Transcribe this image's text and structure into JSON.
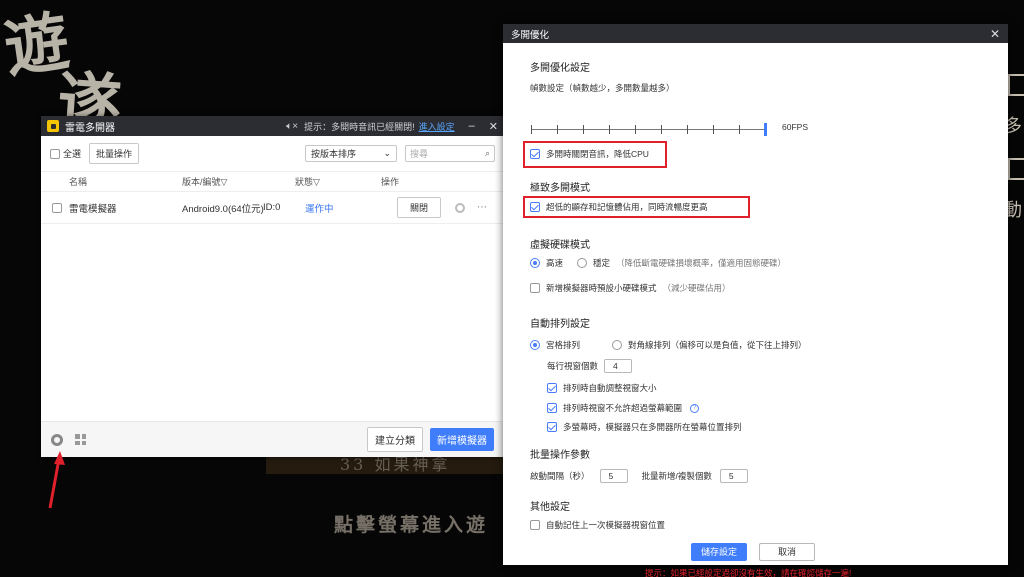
{
  "background": {
    "glyph_a": "遊",
    "glyph_b": "遂",
    "caption_line": "33 如果神拿",
    "caption_sub": "點擊螢幕進入遊",
    "right_glyph_1": "多",
    "right_glyph_2": "動"
  },
  "manager": {
    "title": "雷電多開器",
    "tip": "提示：多開時音訊已經關閉!",
    "tip_link": "進入設定",
    "minimize": "–",
    "close": "✕",
    "select_all": "全選",
    "batch_label": "批量操作",
    "sort_label": "按版本排序",
    "search_placeholder": "搜尋",
    "columns": {
      "name": "名稱",
      "version": "版本/編號",
      "status": "狀態",
      "action": "操作"
    },
    "row": {
      "name": "雷電模擬器",
      "version": "Android9.0(64位元)",
      "id": "ID:0",
      "status": "運作中",
      "action": "關閉",
      "more": "⋯"
    },
    "create_group": "建立分類",
    "new_emulator": "新增模擬器"
  },
  "dialog": {
    "title": "多開優化",
    "close": "✕",
    "section1": {
      "heading": "多開優化設定",
      "fps_label": "幀數設定（幀數越少，多開數量越多）",
      "fps_value_label": "60FPS",
      "fps_level": 1.0,
      "mute_option": "多開時關閉音訊，降低CPU"
    },
    "section2": {
      "heading": "極致多開模式",
      "option": "超低的顯存和記憶體佔用，同時流暢度更高"
    },
    "section3": {
      "heading": "虛擬硬碟模式",
      "radio_fast": "高速",
      "radio_stable": "穩定",
      "stable_note": "（降低斷電硬碟損壞概率，僅適用固態硬碟）",
      "small_disk": "新增模擬器時預設小硬碟模式",
      "small_disk_note": "（減少硬碟佔用）"
    },
    "section4": {
      "heading": "自動排列設定",
      "radio_grid": "宮格排列",
      "radio_diag": "對角線排列（偏移可以是負值，從下往上排列）",
      "per_row_label": "每行視窗個數",
      "per_row_value": "4",
      "opt1": "排列時自動調整視窗大小",
      "opt2": "排列時視窗不允許超過螢幕範圍",
      "opt3": "多螢幕時，模擬器只在多開器所在螢幕位置排列",
      "help": "?"
    },
    "section5": {
      "heading": "批量操作參數",
      "interval_label": "啟動間隔（秒）",
      "interval_value": "5",
      "count_label": "批量新增/複製個數",
      "count_value": "5"
    },
    "section6": {
      "heading": "其他設定",
      "remember": "自動記住上一次模擬器視窗位置"
    },
    "save": "儲存設定",
    "cancel": "取消",
    "hint": "提示：如果已經設定過卻沒有生效，請在確認儲存一遍!"
  },
  "colors": {
    "accent": "#3f7dfb",
    "highlight": "#e0202a",
    "titlebar": "#2b2d33"
  }
}
